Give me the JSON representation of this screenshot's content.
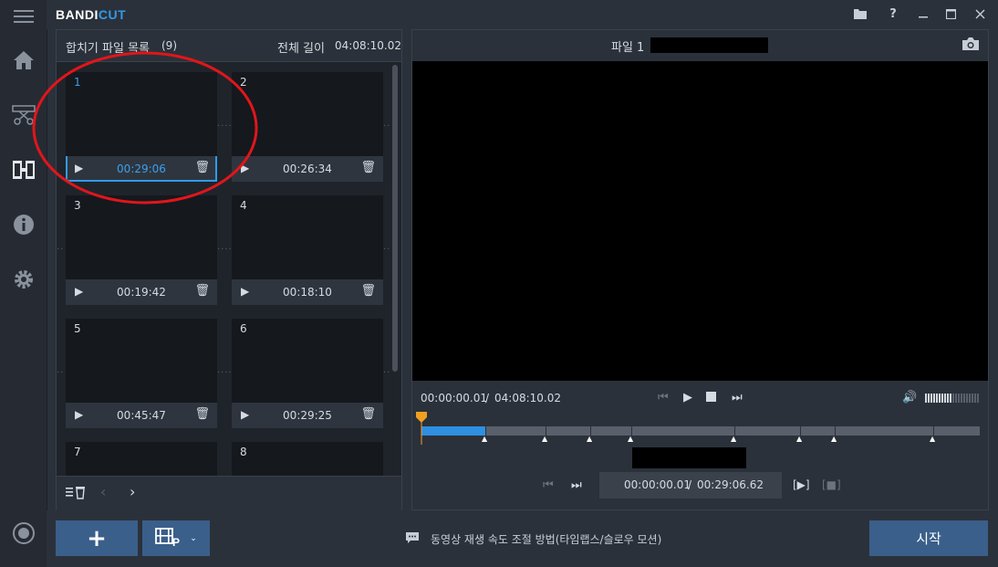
{
  "app": {
    "logo_part1": "BANDI",
    "logo_part2": "CUT"
  },
  "sidebar": {
    "items": [
      {
        "icon": "menu-icon"
      },
      {
        "icon": "home-icon"
      },
      {
        "icon": "cut-icon"
      },
      {
        "icon": "film-join-icon"
      },
      {
        "icon": "info-icon"
      },
      {
        "icon": "gear-icon"
      },
      {
        "icon": "record-icon"
      }
    ]
  },
  "window_controls": [
    "folder-icon",
    "help-icon",
    "minimize-icon",
    "maximize-icon",
    "close-icon"
  ],
  "file_list": {
    "title": "합치기 파일 목록",
    "count": "(9)",
    "total_label": "전체 길이",
    "total_length": "04:08:10.02",
    "items": [
      {
        "num": "1",
        "duration": "00:29:06"
      },
      {
        "num": "2",
        "duration": "00:26:34"
      },
      {
        "num": "3",
        "duration": "00:19:42"
      },
      {
        "num": "4",
        "duration": "00:18:10"
      },
      {
        "num": "5",
        "duration": "00:45:47"
      },
      {
        "num": "6",
        "duration": "00:29:25"
      },
      {
        "num": "7",
        "duration": ""
      },
      {
        "num": "8",
        "duration": ""
      }
    ]
  },
  "preview": {
    "file_label": "파일 1",
    "current_time": "00:00:00.01",
    "separator": "/",
    "total_time": "04:08:10.02",
    "clip_current": "00:00:00.01",
    "clip_total": "00:29:06.62"
  },
  "bottom": {
    "add_label": "+",
    "hint_text": "동영상 재생 속도 조절 방법(타임랩스/슬로우 모션)",
    "start_label": "시작"
  },
  "colors": {
    "accent": "#2f9bea",
    "button": "#3a5f8a",
    "annotation": "#e0161b"
  }
}
